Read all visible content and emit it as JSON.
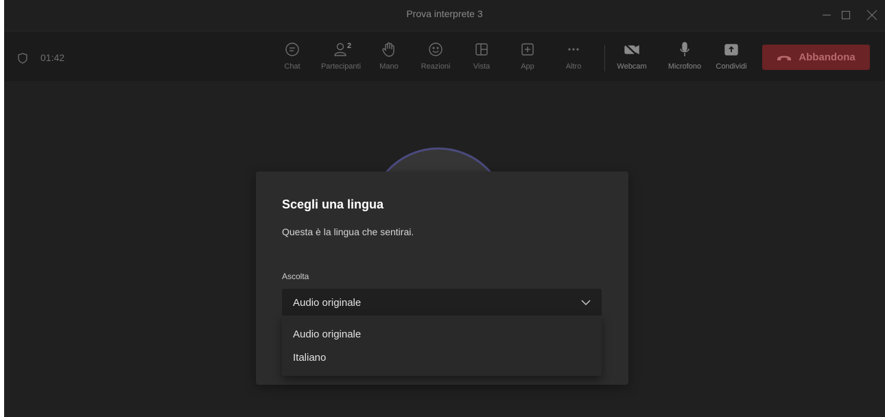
{
  "window": {
    "title": "Prova interprete 3"
  },
  "meeting": {
    "timer": "01:42",
    "controls": [
      {
        "label": "Chat",
        "icon": "chat-icon"
      },
      {
        "label": "Partecipanti",
        "icon": "people-icon",
        "count": "2"
      },
      {
        "label": "Mano",
        "icon": "raise-hand-icon"
      },
      {
        "label": "Reazioni",
        "icon": "smiley-icon"
      },
      {
        "label": "Vista",
        "icon": "layout-icon"
      },
      {
        "label": "App",
        "icon": "add-app-icon"
      },
      {
        "label": "Altro",
        "icon": "more-icon"
      },
      {
        "label": "Webcam",
        "icon": "camera-off-icon"
      },
      {
        "label": "Microfono",
        "icon": "microphone-icon"
      },
      {
        "label": "Condividi",
        "icon": "share-icon"
      }
    ],
    "leave_label": "Abbandona",
    "leave_color": "#6b2325"
  },
  "dialog": {
    "title": "Scegli una lingua",
    "subtitle": "Questa è la lingua che sentirai.",
    "field_label": "Ascolta",
    "selected": "Audio originale",
    "options": [
      "Audio originale",
      "Italiano"
    ]
  }
}
